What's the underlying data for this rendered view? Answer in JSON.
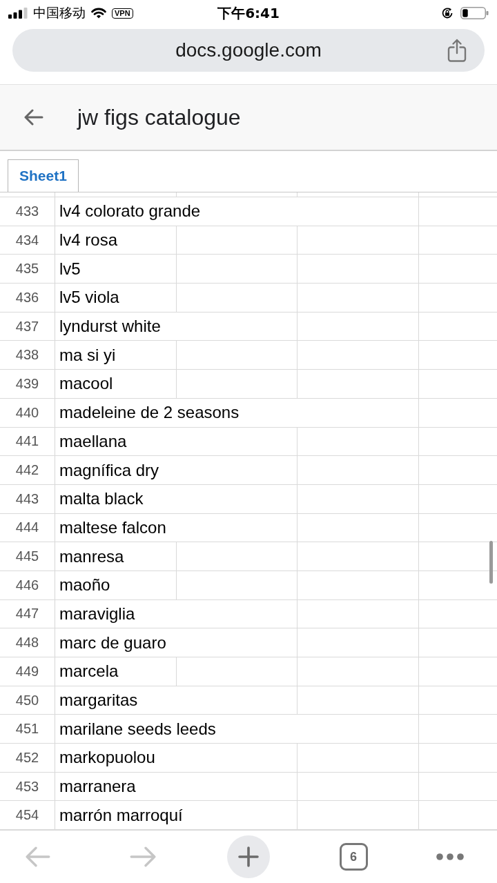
{
  "status_bar": {
    "carrier": "中国移动",
    "vpn": "VPN",
    "time": "下午6:41"
  },
  "address_bar": {
    "url": "docs.google.com"
  },
  "document": {
    "title": "jw figs catalogue"
  },
  "sheet_tabs": [
    {
      "label": "Sheet1",
      "selected": true
    }
  ],
  "rows": [
    {
      "number": "433",
      "text": "lv4 colorato grande",
      "kind": "triple"
    },
    {
      "number": "434",
      "text": "lv4 rosa",
      "kind": "single"
    },
    {
      "number": "435",
      "text": "lv5",
      "kind": "single"
    },
    {
      "number": "436",
      "text": "lv5 viola",
      "kind": "single"
    },
    {
      "number": "437",
      "text": "lyndurst white",
      "kind": "double"
    },
    {
      "number": "438",
      "text": "ma si yi",
      "kind": "single"
    },
    {
      "number": "439",
      "text": "macool",
      "kind": "single"
    },
    {
      "number": "440",
      "text": "madeleine de 2 seasons",
      "kind": "triple"
    },
    {
      "number": "441",
      "text": "maellana",
      "kind": "double"
    },
    {
      "number": "442",
      "text": "magnífica dry",
      "kind": "double"
    },
    {
      "number": "443",
      "text": "malta black",
      "kind": "double"
    },
    {
      "number": "444",
      "text": "maltese falcon",
      "kind": "double"
    },
    {
      "number": "445",
      "text": "manresa",
      "kind": "single"
    },
    {
      "number": "446",
      "text": "maoño",
      "kind": "single"
    },
    {
      "number": "447",
      "text": "maraviglia",
      "kind": "double"
    },
    {
      "number": "448",
      "text": "marc de guaro",
      "kind": "double"
    },
    {
      "number": "449",
      "text": "marcela",
      "kind": "single"
    },
    {
      "number": "450",
      "text": "margaritas",
      "kind": "double"
    },
    {
      "number": "451",
      "text": "marilane seeds leeds",
      "kind": "triple"
    },
    {
      "number": "452",
      "text": "markopuolou",
      "kind": "double"
    },
    {
      "number": "453",
      "text": "marranera",
      "kind": "double"
    },
    {
      "number": "454",
      "text": "marrón marroquí",
      "kind": "double"
    }
  ],
  "toolbar": {
    "back": {
      "disabled": true
    },
    "forward": {
      "disabled": true
    },
    "tab_count": "6"
  }
}
